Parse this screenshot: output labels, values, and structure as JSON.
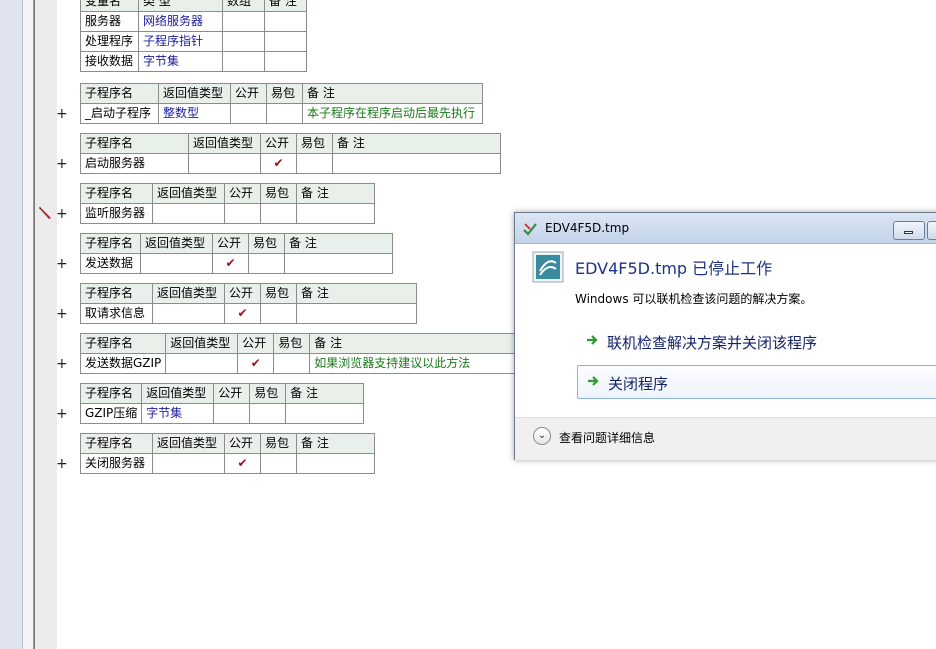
{
  "vars_table": {
    "headers": [
      "变量名",
      "类 型",
      "数组",
      "备 注"
    ],
    "rows": [
      [
        "服务器",
        "网络服务器",
        "",
        ""
      ],
      [
        "处理程序",
        "子程序指针",
        "",
        ""
      ],
      [
        "接收数据",
        "字节集",
        "",
        ""
      ]
    ]
  },
  "sub_headers": [
    "子程序名",
    "返回值类型",
    "公开",
    "易包",
    "备 注"
  ],
  "subs": [
    {
      "name": "_启动子程序",
      "ret": "整数型",
      "public": "",
      "easy": "",
      "note": "本子程序在程序启动后最先执行"
    },
    {
      "name": "启动服务器",
      "ret": "",
      "public": "✔",
      "easy": "",
      "note": ""
    },
    {
      "name": "监听服务器",
      "ret": "",
      "public": "",
      "easy": "",
      "note": ""
    },
    {
      "name": "发送数据",
      "ret": "",
      "public": "✔",
      "easy": "",
      "note": ""
    },
    {
      "name": "取请求信息",
      "ret": "",
      "public": "✔",
      "easy": "",
      "note": ""
    },
    {
      "name": "发送数据GZIP",
      "ret": "",
      "public": "✔",
      "easy": "",
      "note": "如果浏览器支持建议以此方法"
    },
    {
      "name": "GZIP压缩",
      "ret": "字节集",
      "public": "",
      "easy": "",
      "note": ""
    },
    {
      "name": "关闭服务器",
      "ret": "",
      "public": "✔",
      "easy": "",
      "note": ""
    }
  ],
  "plus_symbol": "+",
  "dialog": {
    "title": "EDV4F5D.tmp",
    "heading": "EDV4F5D.tmp 已停止工作",
    "subtitle": "Windows 可以联机检查该问题的解决方案。",
    "option1": "联机检查解决方案并关闭该程序",
    "option2": "关闭程序",
    "details": "查看问题详细信息",
    "chevron": "⌄"
  },
  "colors": {
    "header_bg": "#e9efe9",
    "type_text": "#1c1c9a",
    "note_text": "#1a7a1a",
    "check": "#9a1010",
    "dialog_heading": "#1e3287"
  }
}
